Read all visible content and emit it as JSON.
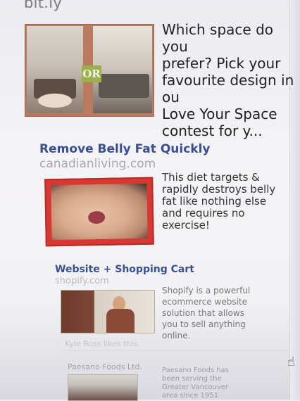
{
  "top": {
    "source": "bit.ly"
  },
  "ads": {
    "space": {
      "image_text": "OR",
      "text": "Which space do you\nprefer? Pick your\nfavourite design in ou\nLove Your Space\ncontest for y..."
    },
    "belly": {
      "title": "Remove Belly Fat Quickly",
      "domain": "canadianliving.com",
      "text": "This diet targets &\nrapidly destroys belly\nfat like nothing else\nand requires no\nexercise!"
    },
    "shopify": {
      "title": "Website + Shopping Cart",
      "domain": "shopify.com",
      "text": "Shopify is a powerful\necommerce website\nsolution that allows\nyou to sell anything\nonline.",
      "like_line": "Kyle Ross likes this."
    },
    "paesano": {
      "title": "Paesano Foods Ltd.",
      "text": "Paesano Foods has\nbeen serving the\nGreater Vancouver\narea since 1951"
    }
  },
  "ui": {
    "pointer_icon": "hand-pointer-icon"
  }
}
